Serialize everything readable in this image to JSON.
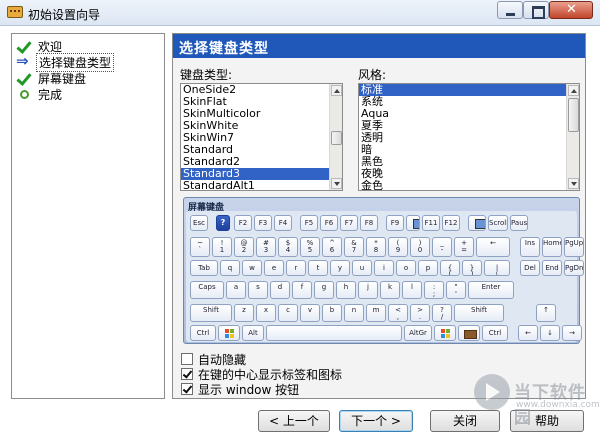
{
  "window": {
    "title": "初始设置向导"
  },
  "nav": {
    "items": [
      {
        "label": "欢迎",
        "icon": "check-icon"
      },
      {
        "label": "选择键盘类型",
        "icon": "arrow-right-icon",
        "active": true
      },
      {
        "label": "屏幕键盘",
        "icon": "check-icon"
      },
      {
        "label": "完成",
        "icon": "bullet-icon"
      }
    ]
  },
  "panel": {
    "header": "选择键盘类型",
    "keyboard_type_label": "键盘类型:",
    "style_label": "风格:",
    "keyboard_types": [
      "OneSide2",
      "SkinFlat",
      "SkinMulticolor",
      "SkinWhite",
      "SkinWin7",
      "Standard",
      "Standard2",
      "Standard3",
      "StandardAlt1"
    ],
    "keyboard_type_selected": "Standard3",
    "styles": [
      "标准",
      "系统",
      "Aqua",
      "夏季",
      "透明",
      "暗",
      "黑色",
      "夜晚",
      "金色"
    ],
    "style_selected": "标准"
  },
  "keyboard": {
    "title": "屏幕键盘",
    "row0": [
      "Esc",
      "",
      "F2",
      "F3",
      "F4",
      "F5",
      "F6",
      "F7",
      "F8",
      "F9",
      "",
      "F11",
      "F12",
      "",
      "Scroll",
      "Pause"
    ],
    "row1": [
      "~\n`",
      "!\n1",
      "@\n2",
      "#\n3",
      "$\n4",
      "%\n5",
      "^\n6",
      "&\n7",
      "*\n8",
      "(\n9",
      ")\n0",
      "_\n-",
      "+\n=",
      "←",
      "Ins",
      "Home",
      "PgUp"
    ],
    "row2": [
      "Tab",
      "q",
      "w",
      "e",
      "r",
      "t",
      "y",
      "u",
      "i",
      "o",
      "p",
      "{\n[",
      "}\n]",
      "|\n\\",
      "Del",
      "End",
      "PgDn"
    ],
    "row3": [
      "Caps",
      "a",
      "s",
      "d",
      "f",
      "g",
      "h",
      "j",
      "k",
      "l",
      ":\n;",
      "\"\n'",
      "Enter"
    ],
    "row4": [
      "Shift",
      "z",
      "x",
      "c",
      "v",
      "b",
      "n",
      "m",
      "<\n,",
      ">\n.",
      "?\n/",
      "Shift",
      "↑"
    ],
    "row5": [
      "Ctrl",
      "",
      "Alt",
      "",
      "AltGr",
      "",
      "",
      "Ctrl",
      "←",
      "↓",
      "→"
    ]
  },
  "options": [
    {
      "label": "自动隐藏",
      "checked": false
    },
    {
      "label": "在键的中心显示标签和图标",
      "checked": true
    },
    {
      "label": "显示 window 按钮",
      "checked": true
    }
  ],
  "buttons": {
    "prev": "< 上一个",
    "next": "下一个 >",
    "close": "关闭",
    "help": "帮助"
  },
  "watermark": {
    "text": "当下软件园",
    "url": "www.downxia.com"
  }
}
